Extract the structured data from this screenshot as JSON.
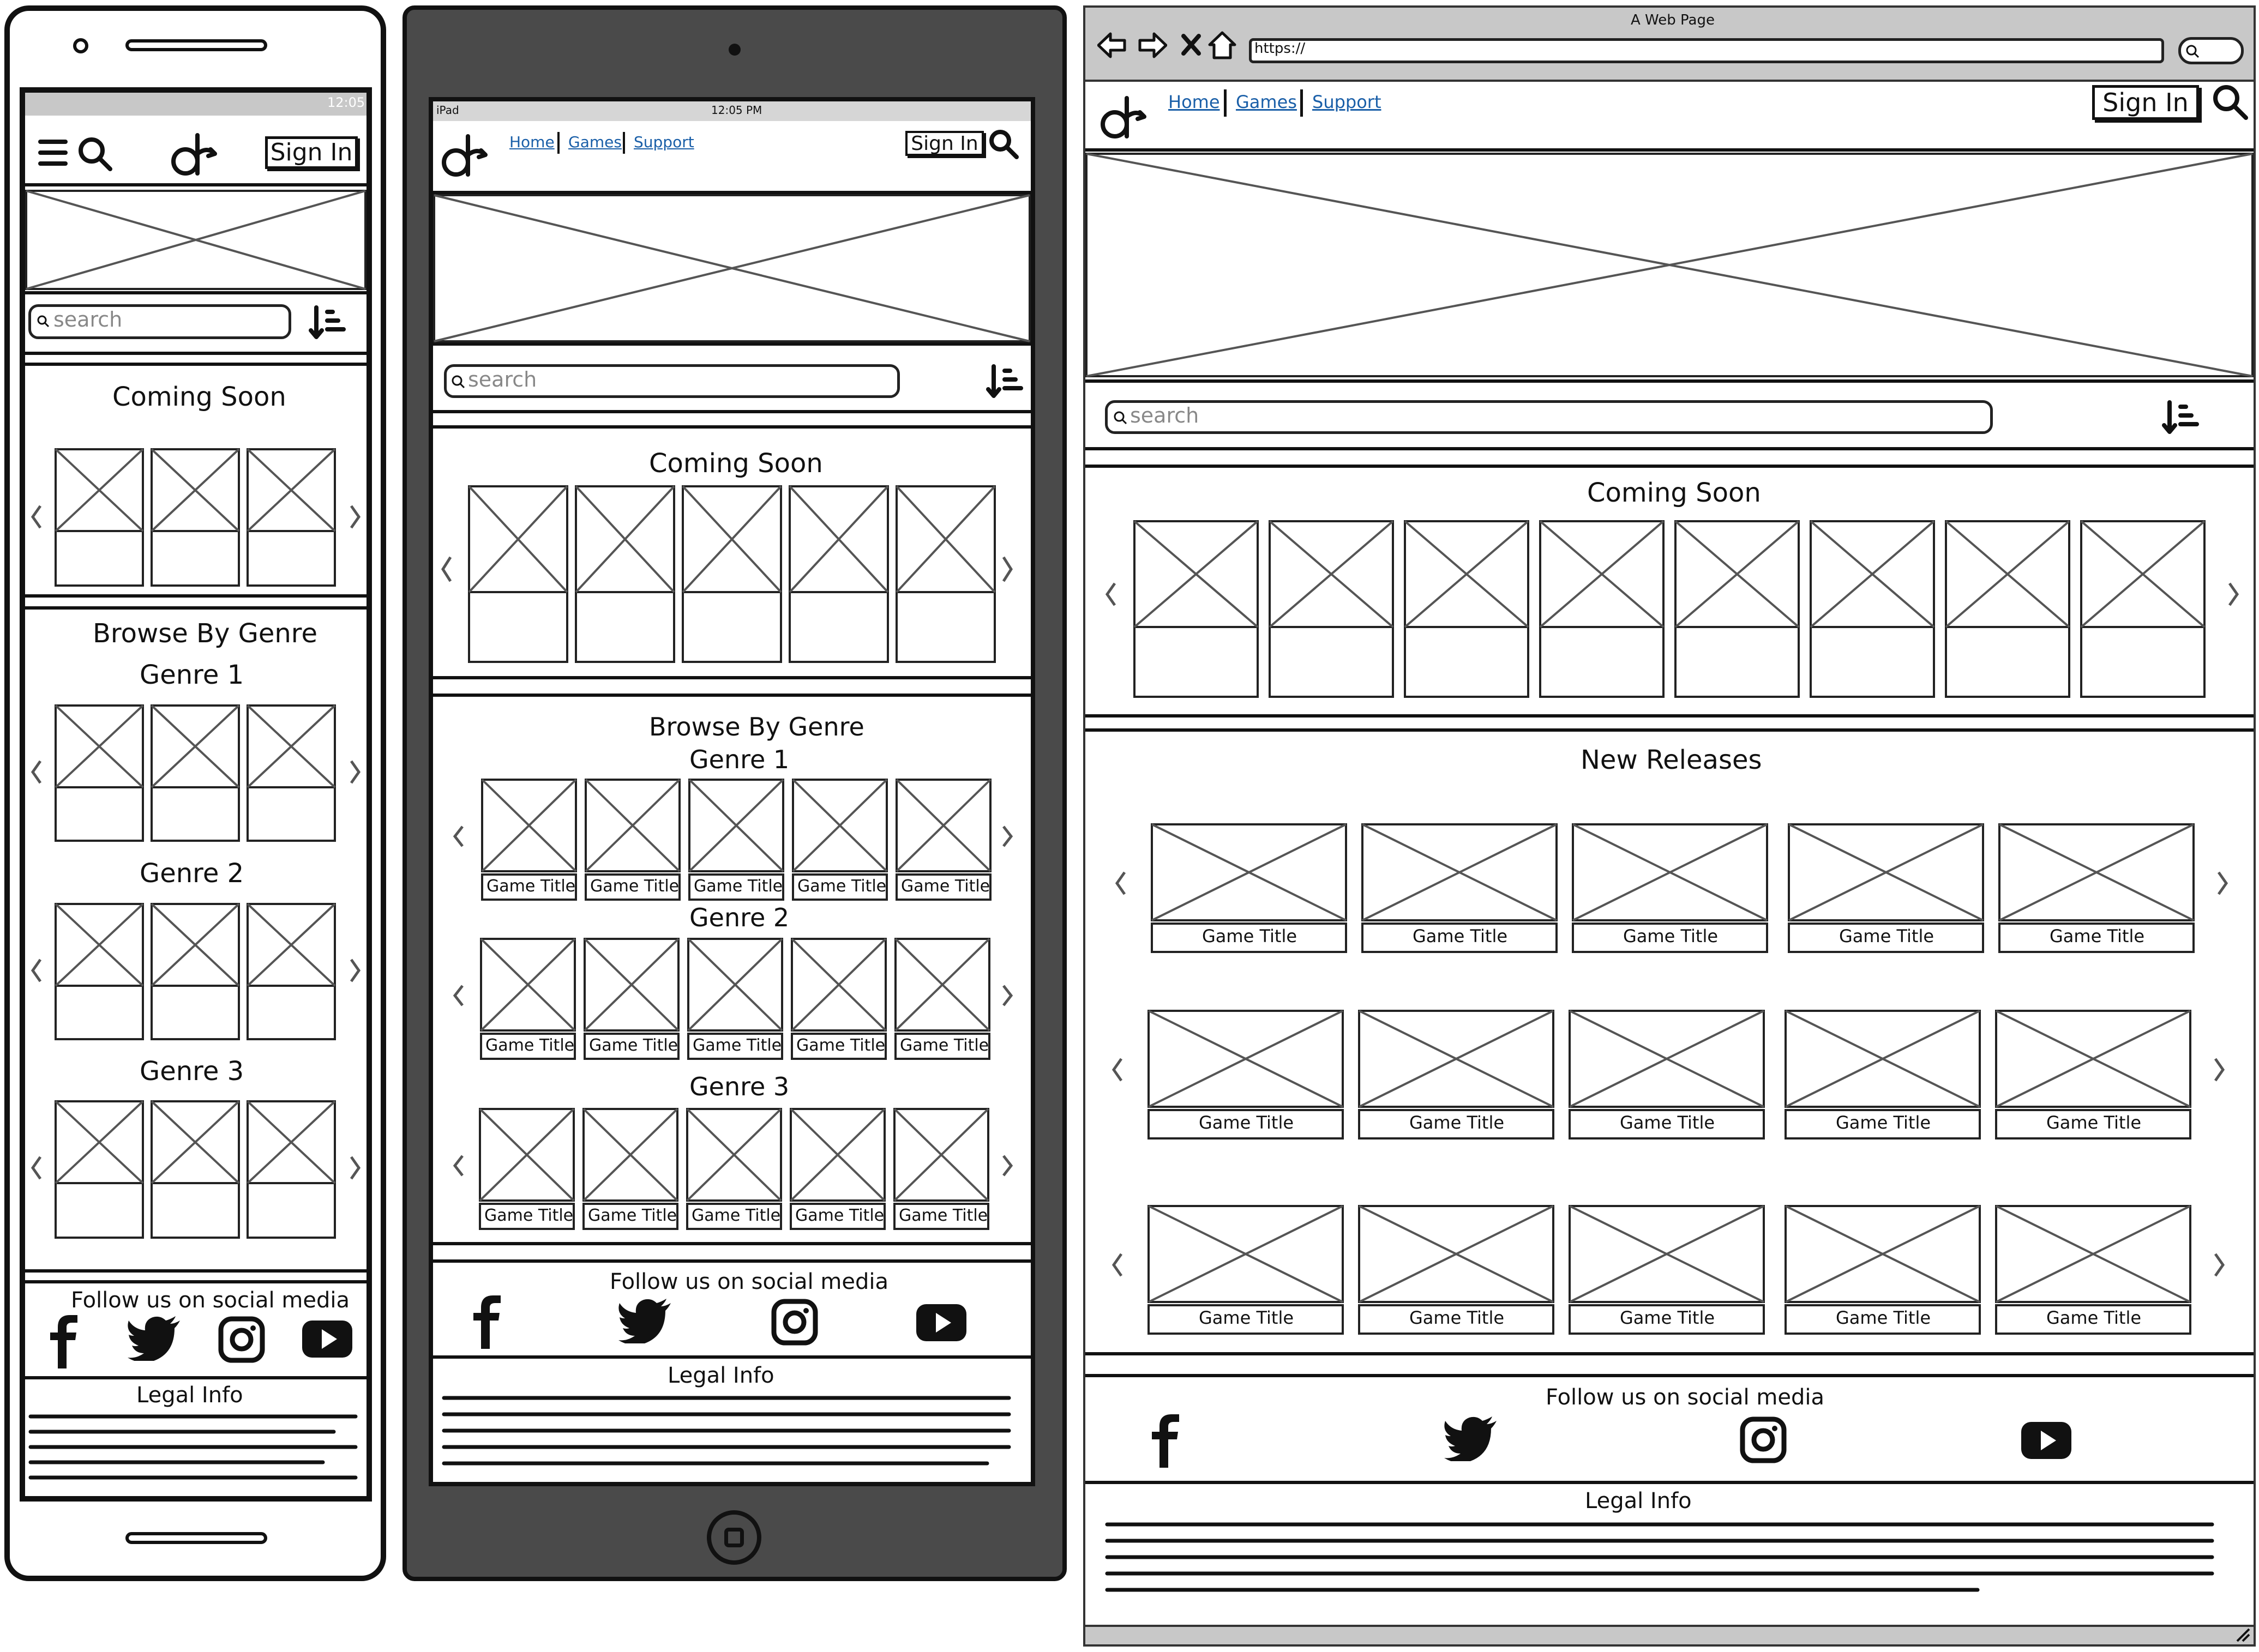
{
  "browser": {
    "window_title": "A Web Page",
    "url": "https://"
  },
  "nav": {
    "home": "Home",
    "games": "Games",
    "support": "Support",
    "sign_in": "Sign In"
  },
  "status": {
    "phone_time": "12:05",
    "tablet_device": "iPad",
    "tablet_time": "12:05 PM"
  },
  "search": {
    "placeholder": "search"
  },
  "sections": {
    "coming_soon": "Coming Soon",
    "browse_by_genre": "Browse By Genre",
    "genres": [
      "Genre 1",
      "Genre 2",
      "Genre 3"
    ],
    "new_releases": "New Releases",
    "game_title": "Game Title"
  },
  "footer": {
    "follow": "Follow us on social media",
    "legal": "Legal Info"
  },
  "icons": [
    "menu-icon",
    "search-icon",
    "logo-icon",
    "sort-icon",
    "chevron-left-icon",
    "chevron-right-icon",
    "facebook-icon",
    "twitter-icon",
    "instagram-icon",
    "youtube-icon",
    "back-icon",
    "forward-icon",
    "close-icon",
    "home-icon"
  ]
}
